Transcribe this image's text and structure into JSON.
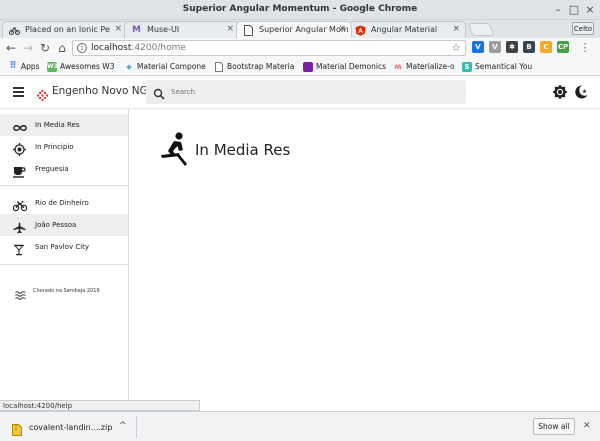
{
  "window": {
    "title": "Superior Angular Momentum - Google Chrome"
  },
  "tabs": [
    {
      "label": "Placed on an Ionic Pe",
      "icon": "bicycle-icon"
    },
    {
      "label": "Muse-UI",
      "icon": "muse-logo-icon"
    },
    {
      "label": "Superior Angular Mom",
      "icon": "page-icon",
      "active": true
    },
    {
      "label": "Angular Material",
      "icon": "angular-logo-icon"
    }
  ],
  "profile": {
    "label": "Celto"
  },
  "omnibox": {
    "host": "localhost",
    "path": ":4200/home"
  },
  "bookmarks": [
    {
      "label": "Apps",
      "icon": "apps-grid-icon",
      "color": "#4285f4"
    },
    {
      "label": "Awesomes W3",
      "icon": "w3-logo-icon",
      "color": "#5cb85c"
    },
    {
      "label": "Material Compone",
      "icon": "material-components-icon",
      "color": "#6aa0e0"
    },
    {
      "label": "Bootstrap Materia",
      "icon": "document-icon",
      "color": "#888888"
    },
    {
      "label": "Material Demonics",
      "icon": "purple-square-icon",
      "color": "#7b1fa2"
    },
    {
      "label": "Materialize-o",
      "icon": "materialize-logo-icon",
      "color": "#ee6e73"
    },
    {
      "label": "Semantical You",
      "icon": "semantic-logo-icon",
      "color": "#35bdb2"
    }
  ],
  "app": {
    "title": "Engenho Novo NG2",
    "search_placeholder": "Search",
    "accent": "#e53935"
  },
  "nav": {
    "group1": [
      {
        "label": "In Media Res",
        "icon": "infinity-icon",
        "selected": true
      },
      {
        "label": "In Principio",
        "icon": "target-icon"
      },
      {
        "label": "Freguesia",
        "icon": "coffee-cup-icon"
      }
    ],
    "group2": [
      {
        "label": "Rio de Dinheiro",
        "icon": "bicycle-icon"
      },
      {
        "label": "João Pessoa",
        "icon": "airplane-icon",
        "selected": true
      },
      {
        "label": "San Pavlov City",
        "icon": "cocktail-icon"
      }
    ],
    "footer": {
      "label": "Chorado na Sambaja 2019",
      "icon": "waves-icon"
    }
  },
  "main": {
    "title": "In Media Res",
    "icon": "rowing-icon"
  },
  "statusbar": {
    "text": "localhost:4200/help"
  },
  "download": {
    "filename": "covalent-landin....zip",
    "show_all": "Show all"
  }
}
